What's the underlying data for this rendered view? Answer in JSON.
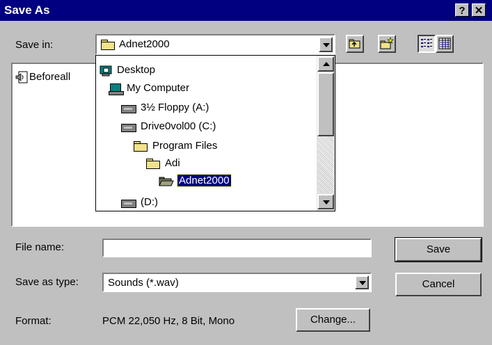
{
  "window": {
    "title": "Save As",
    "help_label": "?",
    "close_label": "✕"
  },
  "save_in": {
    "label": "Save in:",
    "value": "Adnet2000"
  },
  "file_list": {
    "items": [
      {
        "name": "Beforeall",
        "icon": "sound-file-icon"
      }
    ]
  },
  "folder_tree": {
    "items": [
      {
        "label": "Desktop",
        "icon": "desktop-icon"
      },
      {
        "label": "My Computer",
        "icon": "computer-icon"
      },
      {
        "label": "3½ Floppy (A:)",
        "icon": "floppy-drive-icon"
      },
      {
        "label": "Drive0vol00 (C:)",
        "icon": "hard-drive-icon"
      },
      {
        "label": "Program Files",
        "icon": "folder-icon"
      },
      {
        "label": "Adi",
        "icon": "folder-icon"
      },
      {
        "label": "Adnet2000",
        "icon": "open-folder-icon",
        "selected": true
      },
      {
        "label": "(D:)",
        "icon": "hard-drive-icon"
      }
    ]
  },
  "file_name": {
    "label": "File name:",
    "value": ""
  },
  "save_as_type": {
    "label": "Save as type:",
    "value": "Sounds (*.wav)"
  },
  "format": {
    "label": "Format:",
    "value": "PCM 22,050 Hz, 8 Bit, Mono"
  },
  "buttons": {
    "save": "Save",
    "cancel": "Cancel",
    "change": "Change..."
  }
}
